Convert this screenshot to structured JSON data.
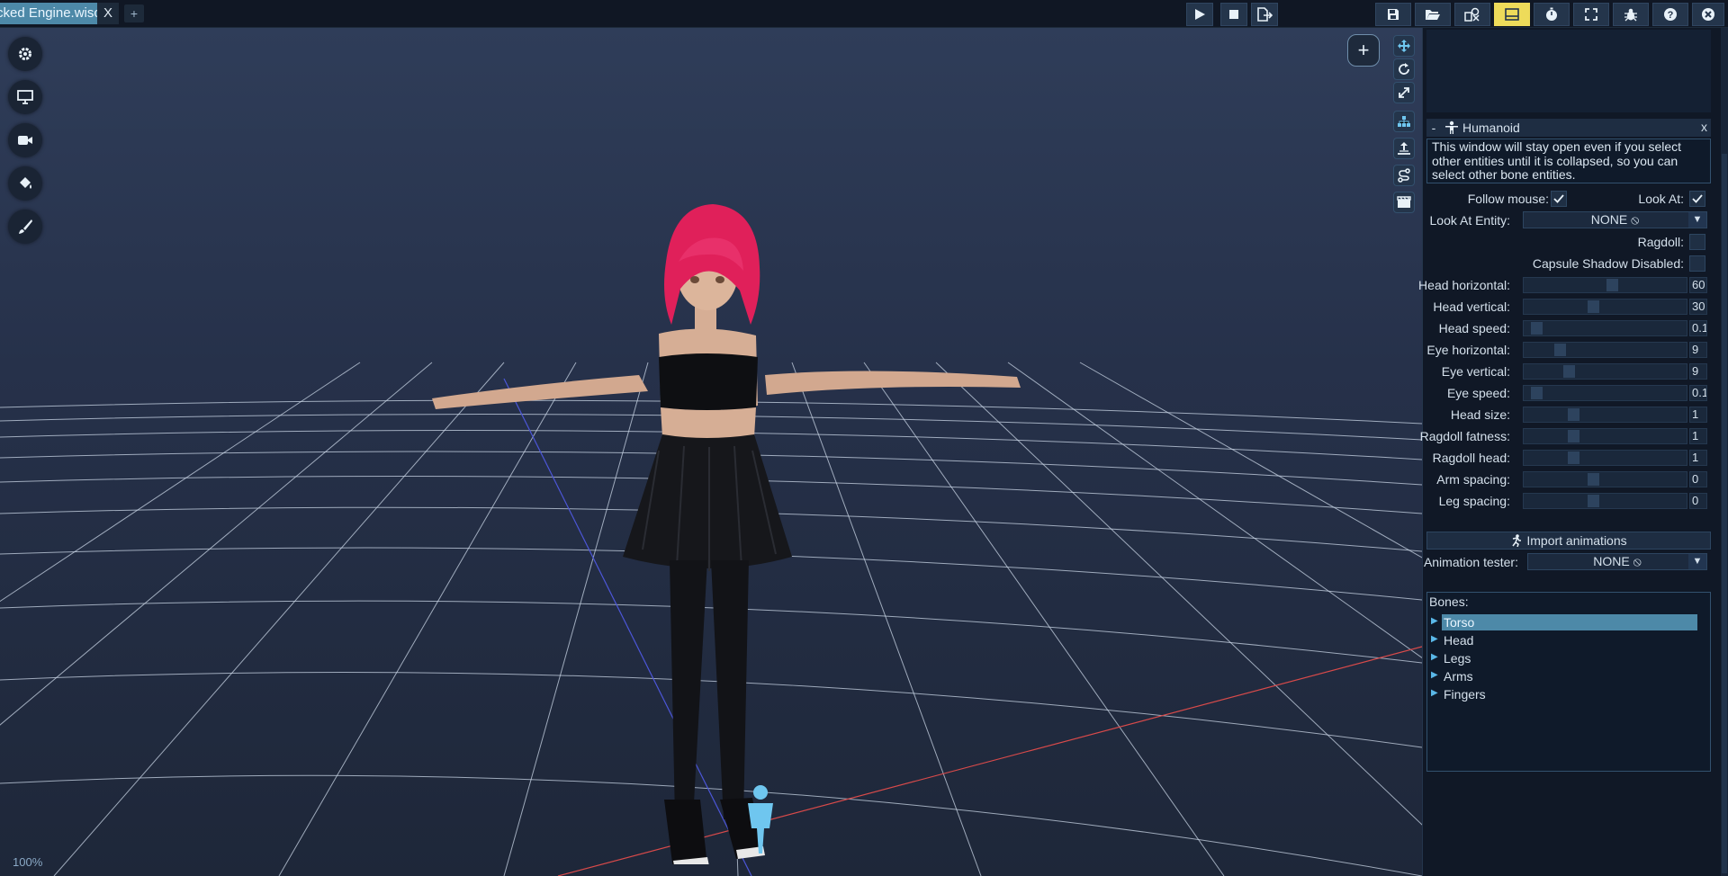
{
  "app": {
    "tab_title": "cked Engine.wiscene",
    "tab_close": "X",
    "tab_add": "+"
  },
  "toolbar": {
    "play": "play-icon",
    "stop": "stop-icon",
    "export": "export-icon",
    "right_icons": [
      "save-icon",
      "open-folder-icon",
      "content-browser-icon",
      "layout-icon",
      "profiler-icon",
      "fullscreen-icon",
      "bug-icon",
      "help-icon",
      "close-icon"
    ],
    "active_icon": "layout-icon",
    "accent": "#eedb5a"
  },
  "viewport": {
    "zoom": "100%",
    "add_button": "+",
    "left_buttons": [
      "gear-icon",
      "monitor-icon",
      "camera-icon",
      "paint-bucket-icon",
      "brush-icon"
    ],
    "right_tools": [
      "translate-icon",
      "rotate-icon",
      "scale-icon",
      "hierarchy-icon",
      "dummy-icon",
      "navigate-icon",
      "film-icon"
    ]
  },
  "humanoid": {
    "title": "Humanoid",
    "collapse": "-",
    "close": "x",
    "info": "This window will stay open even if you select other entities until it is collapsed, so you can select other bone entities.",
    "follow_mouse_label": "Follow mouse:",
    "follow_mouse": true,
    "look_at_label": "Look At:",
    "look_at": true,
    "look_at_entity_label": "Look At Entity:",
    "look_at_entity_value": "NONE",
    "ragdoll_label": "Ragdoll:",
    "ragdoll": false,
    "capsule_shadow_label": "Capsule Shadow Disabled:",
    "capsule_shadow": false,
    "sliders": [
      {
        "label": "Head horizontal:",
        "value": "60",
        "fill": 0.55
      },
      {
        "label": "Head vertical:",
        "value": "30",
        "fill": 0.42
      },
      {
        "label": "Head speed:",
        "value": "0.1",
        "fill": 0.05
      },
      {
        "label": "Eye horizontal:",
        "value": "9",
        "fill": 0.2
      },
      {
        "label": "Eye vertical:",
        "value": "9",
        "fill": 0.26
      },
      {
        "label": "Eye speed:",
        "value": "0.1",
        "fill": 0.05
      },
      {
        "label": "Head size:",
        "value": "1",
        "fill": 0.29
      },
      {
        "label": "Ragdoll fatness:",
        "value": "1",
        "fill": 0.29
      },
      {
        "label": "Ragdoll head:",
        "value": "1",
        "fill": 0.29
      },
      {
        "label": "Arm spacing:",
        "value": "0",
        "fill": 0.42
      },
      {
        "label": "Leg spacing:",
        "value": "0",
        "fill": 0.42
      }
    ],
    "import_animations": "Import animations",
    "animation_tester_label": "Animation tester:",
    "animation_tester_value": "NONE",
    "bones_title": "Bones:",
    "bones": [
      "Torso",
      "Head",
      "Legs",
      "Arms",
      "Fingers"
    ],
    "selected_bone": "Torso"
  }
}
